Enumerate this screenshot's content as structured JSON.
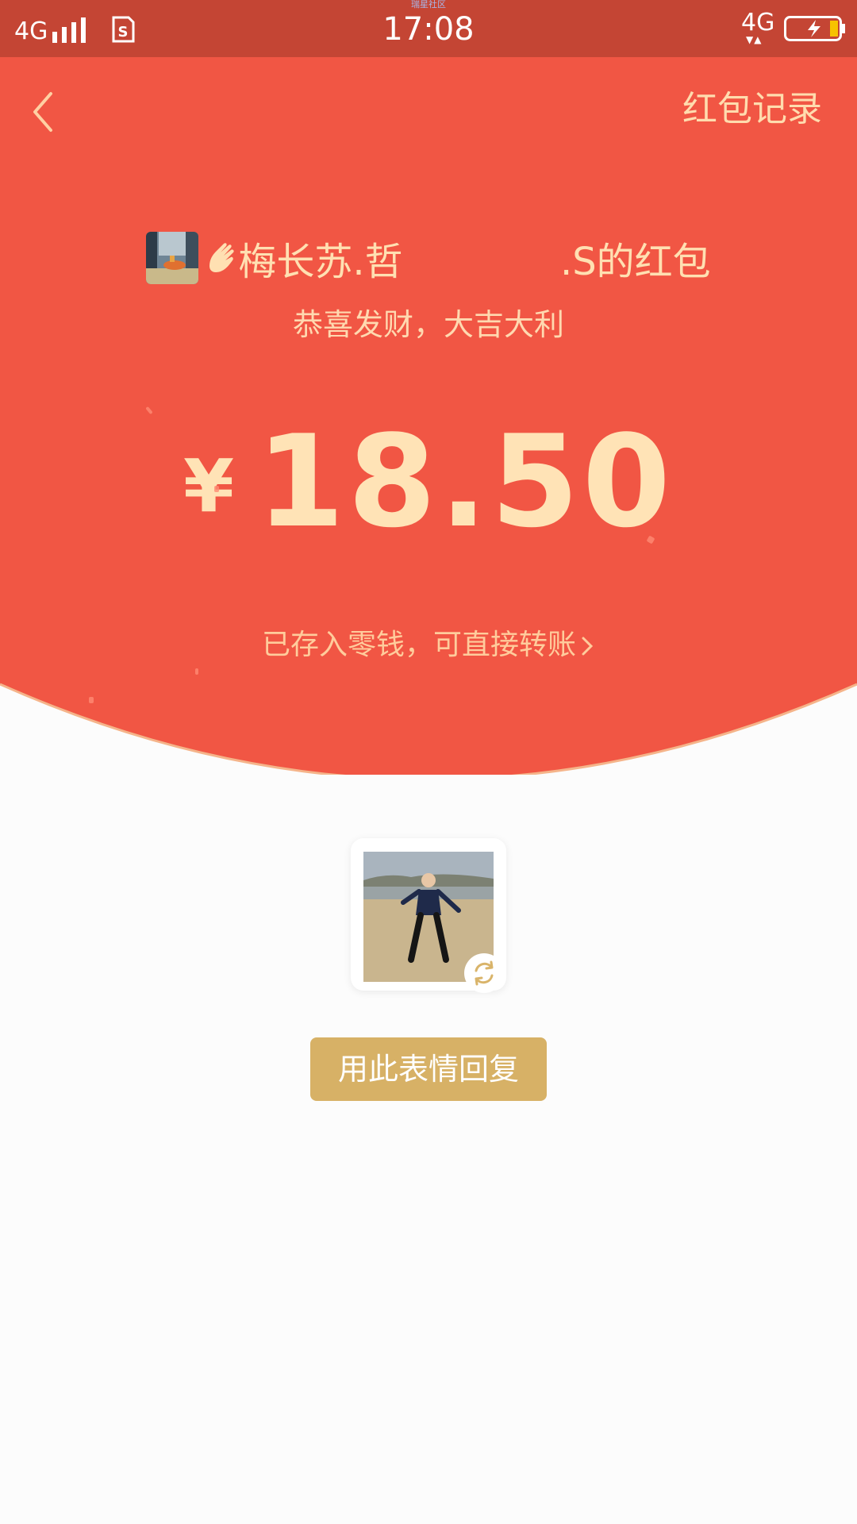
{
  "status_bar": {
    "network_left": "4G",
    "network_right": "4G",
    "time": "17:08",
    "caption": "瑞星社区"
  },
  "header": {
    "records_label": "红包记录",
    "sender_name": "梅长苏.哲             .S的红包",
    "blessing": "恭喜发财，大吉大利",
    "currency_symbol": "¥",
    "amount": "18.50",
    "deposit_text": "已存入零钱，可直接转账"
  },
  "sticker": {
    "reply_button_label": "用此表情回复"
  },
  "colors": {
    "header_red": "#f15644",
    "status_bar": "#c44534",
    "gold_text": "#ffe3b6",
    "button_gold": "#d7b166"
  }
}
